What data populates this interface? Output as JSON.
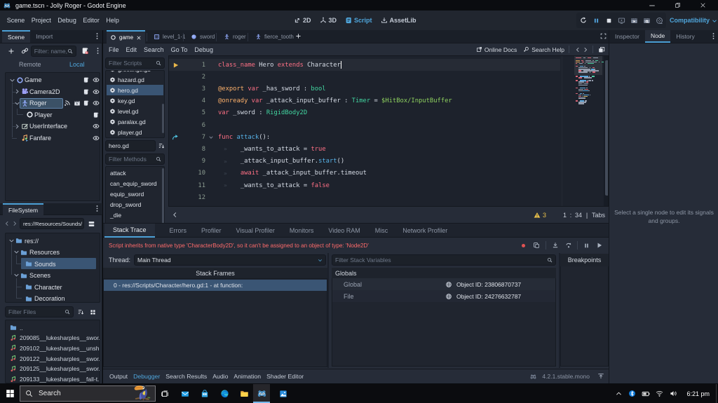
{
  "window": {
    "title": "game.tscn - Jolly Roger - Godot Engine",
    "controls": {
      "minimize": "—",
      "restore": "restore",
      "close": "✕"
    }
  },
  "menubar": {
    "items": [
      "Scene",
      "Project",
      "Debug",
      "Editor",
      "Help"
    ],
    "workspaces": [
      {
        "label": "2D",
        "icon": "ws2d",
        "active": false
      },
      {
        "label": "3D",
        "icon": "ws3d",
        "active": false
      },
      {
        "label": "Script",
        "icon": "wsscript",
        "active": true
      },
      {
        "label": "AssetLib",
        "icon": "assetlib",
        "active": false
      }
    ],
    "playback": [
      "reload",
      "pause",
      "stop",
      "remote",
      "playscene",
      "playcustom",
      "movie"
    ],
    "renderer": "Compatibility"
  },
  "scene_tabs": {
    "tabs": [
      {
        "label": "game",
        "icon": "scene-ring",
        "active": true
      },
      {
        "label": "level_1-1",
        "icon": "level"
      },
      {
        "label": "sword",
        "icon": "ball"
      },
      {
        "label": "roger",
        "icon": "character"
      },
      {
        "label": "fierce_tooth",
        "icon": "character"
      }
    ],
    "add_label": "+"
  },
  "scene_dock": {
    "tabs": [
      "Scene",
      "Import"
    ],
    "filter_placeholder": "Filter: name, ",
    "modes": [
      "Remote",
      "Local"
    ],
    "active_mode": "Local",
    "tree": [
      {
        "label": "Game",
        "icon": "node2d-ring",
        "depth": 0,
        "chevron": "down",
        "badges": [
          "script",
          "eye"
        ]
      },
      {
        "label": "Camera2D",
        "icon": "camera",
        "depth": 1,
        "chevron": "right",
        "badges": [
          "script",
          "eye"
        ]
      },
      {
        "label": "Roger",
        "icon": "character",
        "depth": 1,
        "chevron": "down",
        "selected": true,
        "badges": [
          "signal",
          "group",
          "script",
          "eye"
        ]
      },
      {
        "label": "Player",
        "icon": "node-ring",
        "depth": 2,
        "chevron": "none",
        "badges": [
          "script"
        ]
      },
      {
        "label": "UserInterface",
        "icon": "control",
        "depth": 1,
        "chevron": "right",
        "badges": [
          "eye"
        ]
      },
      {
        "label": "Fanfare",
        "icon": "audio",
        "depth": 1,
        "chevron": "none",
        "badges": [
          "eye"
        ]
      }
    ]
  },
  "filesystem": {
    "title": "FileSystem",
    "path": "res://Resources/Sounds/",
    "tree": [
      {
        "label": "res://",
        "depth": 0,
        "chevron": "down"
      },
      {
        "label": "Resources",
        "depth": 1,
        "chevron": "down"
      },
      {
        "label": "Sounds",
        "depth": 2,
        "chevron": "none",
        "selected": true
      },
      {
        "label": "Scenes",
        "depth": 1,
        "chevron": "down"
      },
      {
        "label": "Character",
        "depth": 2,
        "chevron": "none"
      },
      {
        "label": "Decoration",
        "depth": 2,
        "chevron": "none"
      }
    ],
    "filter_placeholder": "Filter Files",
    "files": [
      {
        "icon": "folder",
        "label": ".."
      },
      {
        "icon": "audio-file",
        "label": "209085__lukesharples__swor..."
      },
      {
        "icon": "audio-file",
        "label": "209102__lukesharples__unsh..."
      },
      {
        "icon": "audio-file",
        "label": "209122__lukesharples__swor..."
      },
      {
        "icon": "audio-file",
        "label": "209125__lukesharples__swor..."
      },
      {
        "icon": "audio-file",
        "label": "209133__lukesharples__fall-t..."
      }
    ]
  },
  "script_editor": {
    "menu": [
      "File",
      "Edit",
      "Search",
      "Go To",
      "Debug"
    ],
    "online_docs": "Online Docs",
    "search_help": "Search Help",
    "filter_scripts_placeholder": "Filter Scripts",
    "scripts": [
      {
        "label": "greetings.gd",
        "clipped": true
      },
      {
        "label": "hazard.gd"
      },
      {
        "label": "hero.gd",
        "selected": true
      },
      {
        "label": "key.gd"
      },
      {
        "label": "level.gd"
      },
      {
        "label": "paralax.gd"
      },
      {
        "label": "player.gd"
      }
    ],
    "current_script": "hero.gd",
    "filter_methods_placeholder": "Filter Methods",
    "methods": [
      "attack",
      "can_equip_sword",
      "equip_sword",
      "drop_sword",
      "_die"
    ],
    "status": {
      "warnings": "3",
      "line": "1",
      "colon": ":",
      "column": "34",
      "pipe": "|",
      "indent": "Tabs"
    }
  },
  "code": {
    "lines": [
      {
        "n": "1",
        "exec": true,
        "cursor": true,
        "tokens": [
          [
            "kw",
            "class_name"
          ],
          [
            "txt",
            " Hero "
          ],
          [
            "kw",
            "extends"
          ],
          [
            "txt",
            " Character"
          ]
        ]
      },
      {
        "n": "2",
        "tokens": []
      },
      {
        "n": "3",
        "tokens": [
          [
            "ann",
            "@export"
          ],
          [
            "txt",
            " "
          ],
          [
            "kw",
            "var"
          ],
          [
            "txt",
            " _has_sword : "
          ],
          [
            "type",
            "bool"
          ]
        ]
      },
      {
        "n": "4",
        "tokens": [
          [
            "ann",
            "@onready"
          ],
          [
            "txt",
            " "
          ],
          [
            "kw",
            "var"
          ],
          [
            "txt",
            " _attack_input_buffer : "
          ],
          [
            "type",
            "Timer"
          ],
          [
            "txt",
            " = "
          ],
          [
            "path",
            "$HitBox/InputBuffer"
          ]
        ]
      },
      {
        "n": "5",
        "tokens": [
          [
            "kw",
            "var"
          ],
          [
            "txt",
            " _sword : "
          ],
          [
            "type",
            "RigidBody2D"
          ]
        ]
      },
      {
        "n": "6",
        "tokens": []
      },
      {
        "n": "7",
        "signal": true,
        "fold": true,
        "tokens": [
          [
            "kw",
            "func"
          ],
          [
            "txt",
            " "
          ],
          [
            "fn",
            "attack"
          ],
          [
            "txt",
            "():"
          ]
        ]
      },
      {
        "n": "8",
        "indent": 1,
        "tokens": [
          [
            "txt",
            "_wants_to_attack = "
          ],
          [
            "kw",
            "true"
          ]
        ]
      },
      {
        "n": "9",
        "indent": 1,
        "tokens": [
          [
            "txt",
            "_attack_input_buffer."
          ],
          [
            "fn",
            "start"
          ],
          [
            "txt",
            "()"
          ]
        ]
      },
      {
        "n": "10",
        "indent": 1,
        "tokens": [
          [
            "kw",
            "await"
          ],
          [
            "txt",
            " _attack_input_buffer.timeout"
          ]
        ]
      },
      {
        "n": "11",
        "indent": 1,
        "tokens": [
          [
            "txt",
            "_wants_to_attack = "
          ],
          [
            "kw",
            "false"
          ]
        ]
      },
      {
        "n": "12",
        "tokens": []
      }
    ],
    "minimap_tail": [
      [],
      [
        [
          "kw",
          4
        ],
        [
          "sp",
          1
        ],
        [
          "fn",
          15
        ],
        [
          "op",
          2
        ],
        [
          "sp",
          1
        ],
        [
          "type",
          5
        ]
      ],
      [
        [
          "sp",
          4
        ],
        [
          "kw",
          6
        ],
        [
          "sp",
          1
        ],
        [
          "txt",
          14
        ]
      ],
      [],
      [
        [
          "kw",
          4
        ],
        [
          "sp",
          1
        ],
        [
          "fn",
          11
        ],
        [
          "op",
          1
        ],
        [
          "txt",
          6
        ],
        [
          "op",
          2
        ]
      ],
      [
        [
          "sp",
          4
        ],
        [
          "txt",
          10
        ],
        [
          "op",
          2
        ],
        [
          "kw",
          4
        ]
      ],
      [
        [
          "sp",
          4
        ],
        [
          "txt",
          6
        ],
        [
          "op",
          2
        ],
        [
          "txt",
          7
        ]
      ],
      [
        [
          "sp",
          4
        ],
        [
          "txt",
          16
        ]
      ],
      [],
      [
        [
          "kw",
          4
        ],
        [
          "sp",
          1
        ],
        [
          "fn",
          10
        ],
        [
          "op",
          3
        ]
      ],
      [
        [
          "sp",
          4
        ],
        [
          "txt",
          9
        ],
        [
          "op",
          2
        ],
        [
          "kw",
          5
        ]
      ],
      [
        [
          "sp",
          4
        ],
        [
          "txt",
          7
        ],
        [
          "fn",
          9
        ],
        [
          "op",
          2
        ]
      ],
      [],
      [
        [
          "kw",
          4
        ],
        [
          "sp",
          1
        ],
        [
          "fn",
          4
        ],
        [
          "op",
          3
        ]
      ],
      [
        [
          "sp",
          4
        ],
        [
          "txt",
          5
        ],
        [
          "op",
          1
        ],
        [
          "fn",
          10
        ],
        [
          "op",
          2
        ]
      ],
      [
        [
          "sp",
          4
        ],
        [
          "kw",
          5
        ],
        [
          "op",
          1
        ],
        [
          "str",
          8
        ]
      ],
      [
        [
          "sp",
          4
        ],
        [
          "txt",
          12
        ]
      ],
      [],
      [
        [
          "kw",
          4
        ],
        [
          "sp",
          1
        ],
        [
          "fn",
          8
        ],
        [
          "op",
          3
        ]
      ],
      [
        [
          "sp",
          4
        ],
        [
          "txt",
          14
        ]
      ],
      [
        [
          "sp",
          4
        ],
        [
          "txt",
          10
        ]
      ],
      []
    ]
  },
  "debugger": {
    "tabs": [
      "Stack Trace",
      "Errors",
      "Profiler",
      "Visual Profiler",
      "Monitors",
      "Video RAM",
      "Misc",
      "Network Profiler"
    ],
    "active_tab": "Stack Trace",
    "error": "Script inherits from native type 'CharacterBody2D', so it can't be assigned to an object of type: 'Node2D'",
    "thread_label": "Thread:",
    "thread_value": "Main Thread",
    "stack_frames_title": "Stack Frames",
    "frame": "0 - res://Scripts/Character/hero.gd:1 - at function:",
    "filter_placeholder": "Filter Stack Variables",
    "globals_title": "Globals",
    "vars": [
      {
        "name": "Global",
        "value": "Object ID: 23806870737"
      },
      {
        "name": "File",
        "value": "Object ID: 24276632787"
      }
    ],
    "breakpoints_title": "Breakpoints"
  },
  "bottom_bar": {
    "items": [
      "Output",
      "Debugger",
      "Search Results",
      "Audio",
      "Animation",
      "Shader Editor"
    ],
    "active": "Debugger",
    "version": "4.2.1.stable.mono"
  },
  "node_dock": {
    "tabs": [
      "Inspector",
      "Node",
      "History"
    ],
    "active_tab": "Node",
    "empty_line1": "Select a single node to edit its signals",
    "empty_line2": "and groups."
  },
  "taskbar": {
    "search_placeholder": "Search",
    "apps": [
      "taskview",
      "mail",
      "store",
      "edge",
      "explorer",
      "godot",
      "photos"
    ],
    "running_app": "godot",
    "time": "6:21 pm"
  },
  "colors": {
    "accent": "#4fa6dc",
    "error": "#ff6b6b",
    "warning": "#e8c04a",
    "selection": "#3a5574"
  }
}
